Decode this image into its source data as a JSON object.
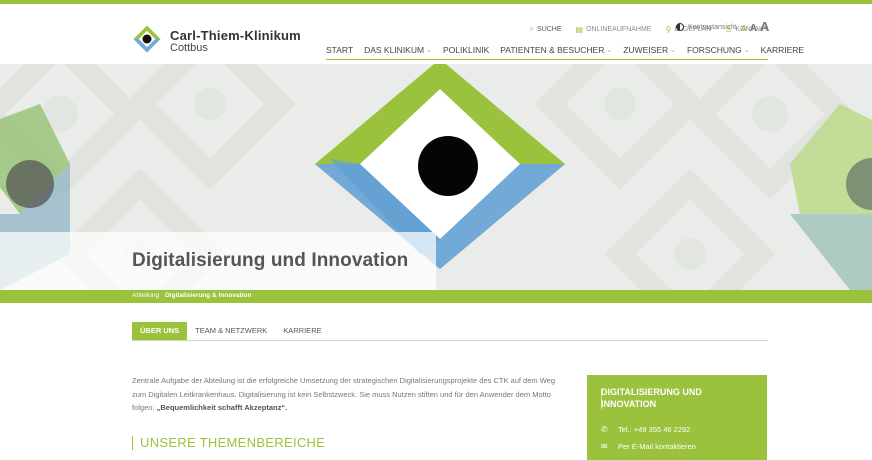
{
  "brand": {
    "name": "Carl-Thiem-Klinikum",
    "city": "Cottbus"
  },
  "utility": [
    {
      "icon": "search-icon",
      "glyph": "⌕",
      "label": "SUCHE"
    },
    {
      "icon": "document-icon",
      "glyph": "▤",
      "label": "ONLINEAUFNAHME"
    },
    {
      "icon": "map-pin-icon",
      "glyph": "⚲",
      "label": "LAGEPLAN"
    },
    {
      "icon": "person-icon",
      "glyph": "♙",
      "label": "KONTAKT"
    }
  ],
  "contrast_label": "Kontrastansicht",
  "font_sizes": [
    "A",
    "A",
    "A"
  ],
  "nav": [
    {
      "label": "START",
      "dropdown": false
    },
    {
      "label": "DAS KLINIKUM",
      "dropdown": true
    },
    {
      "label": "POLIKLINIK",
      "dropdown": false
    },
    {
      "label": "PATIENTEN & BESUCHER",
      "dropdown": true
    },
    {
      "label": "ZUWEISER",
      "dropdown": true
    },
    {
      "label": "FORSCHUNG",
      "dropdown": true
    },
    {
      "label": "KARRIERE",
      "dropdown": false
    }
  ],
  "hero": {
    "title": "Digitalisierung und Innovation"
  },
  "breadcrumbs": [
    "Abteilung",
    "Digitalisierung & Innovation"
  ],
  "tabs": [
    {
      "label": "ÜBER UNS",
      "active": true
    },
    {
      "label": "TEAM & NETZWERK",
      "active": false
    },
    {
      "label": "KARRIERE",
      "active": false
    }
  ],
  "intro": {
    "text": "Zentrale Aufgabe der Abteilung ist die erfolgreiche Umsetzung der strategischen Digitalisierungsprojekte des CTK auf dem Weg zum Digitalen Leitkrankenhaus. Digitalisierung ist kein Selbstzweck. Sie muss Nutzen stiften und für den Anwender dem Motto folgen: ",
    "motto": "„Bequemlichkeit schafft Akzeptanz“."
  },
  "section_title": "UNSERE THEMENBEREICHE",
  "contact_card": {
    "title": "DIGITALISIERUNG UND INNOVATION",
    "phone": "Tel.: +49 355 46 2292",
    "email": "Per E-Mail kontaktieren"
  },
  "colors": {
    "brand_green": "#9ac23c",
    "brand_blue": "#72a9d6",
    "text": "#555555"
  }
}
